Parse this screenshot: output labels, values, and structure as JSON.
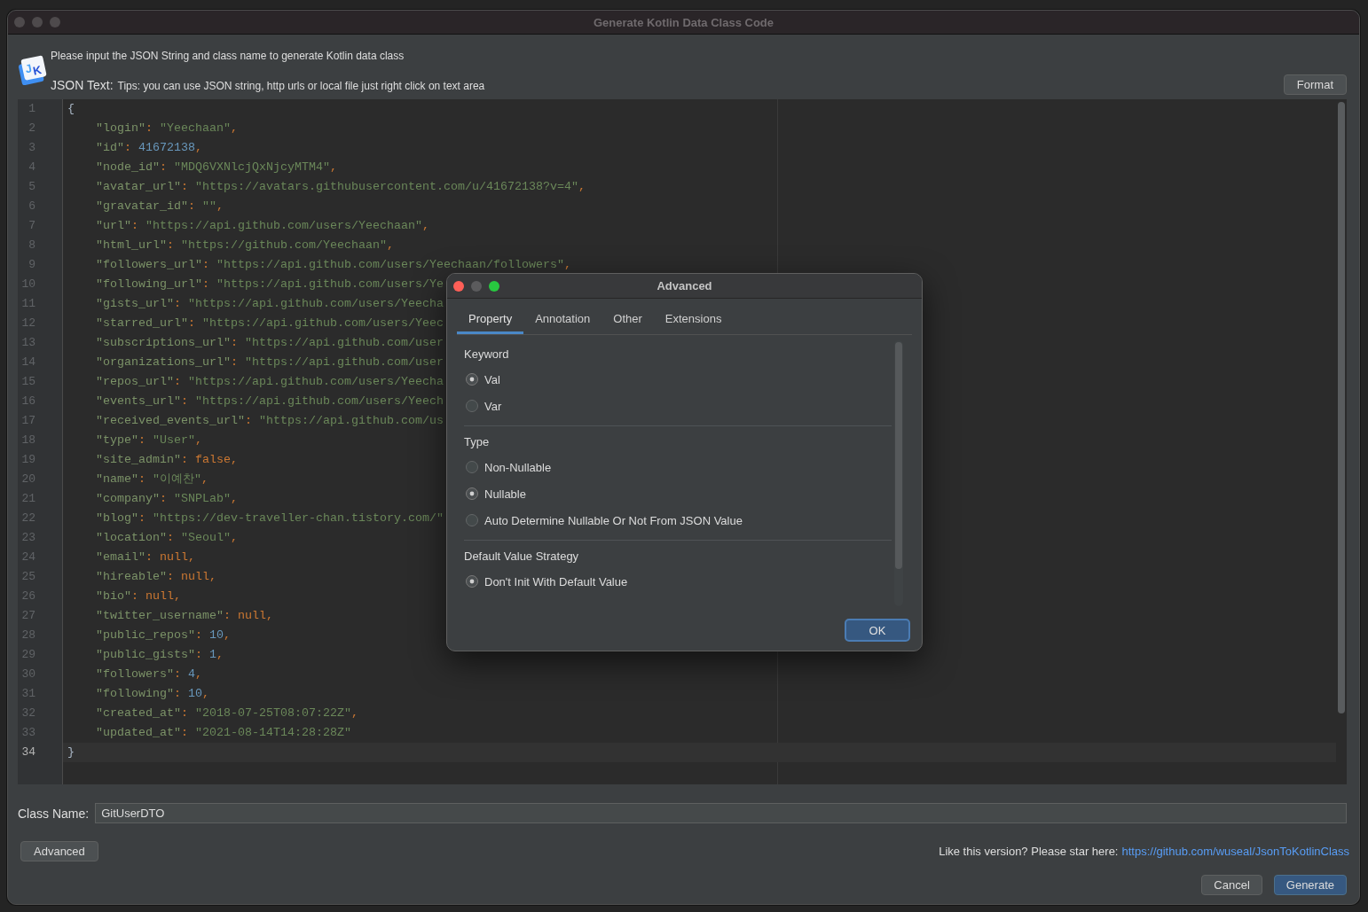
{
  "window": {
    "title": "Generate Kotlin Data Class Code",
    "active": false
  },
  "header": {
    "logo_letters": [
      "J",
      "K"
    ],
    "instruction": "Please input the JSON String and class name to generate Kotlin data class",
    "json_text_label": "JSON Text:",
    "tips": "Tips: you can use JSON string, http urls or local file just right click on text area",
    "format_button": "Format"
  },
  "editor": {
    "lines": [
      {
        "number": "1",
        "current": false,
        "tokens": [
          {
            "kind": "brace",
            "text": "{"
          }
        ],
        "children": [
          {
            "number": "2",
            "current": false,
            "tokens": [
              {
                "kind": "key",
                "text": "\"login\""
              },
              {
                "kind": "punct",
                "text": ": "
              },
              {
                "kind": "string",
                "text": "\"Yeechaan\""
              },
              {
                "kind": "punct",
                "text": ","
              }
            ]
          },
          {
            "number": "3",
            "current": false,
            "tokens": [
              {
                "kind": "key",
                "text": "\"id\""
              },
              {
                "kind": "punct",
                "text": ": "
              },
              {
                "kind": "number",
                "text": "41672138"
              },
              {
                "kind": "punct",
                "text": ","
              }
            ]
          },
          {
            "number": "4",
            "current": false,
            "tokens": [
              {
                "kind": "key",
                "text": "\"node_id\""
              },
              {
                "kind": "punct",
                "text": ": "
              },
              {
                "kind": "string",
                "text": "\"MDQ6VXNlcjQxNjcyMTM4\""
              },
              {
                "kind": "punct",
                "text": ","
              }
            ]
          },
          {
            "number": "5",
            "current": false,
            "tokens": [
              {
                "kind": "key",
                "text": "\"avatar_url\""
              },
              {
                "kind": "punct",
                "text": ": "
              },
              {
                "kind": "string",
                "text": "\"https://avatars.githubusercontent.com/u/41672138?v=4\""
              },
              {
                "kind": "punct",
                "text": ","
              }
            ]
          },
          {
            "number": "6",
            "current": false,
            "tokens": [
              {
                "kind": "key",
                "text": "\"gravatar_id\""
              },
              {
                "kind": "punct",
                "text": ": "
              },
              {
                "kind": "string",
                "text": "\"\""
              },
              {
                "kind": "punct",
                "text": ","
              }
            ]
          },
          {
            "number": "7",
            "current": false,
            "tokens": [
              {
                "kind": "key",
                "text": "\"url\""
              },
              {
                "kind": "punct",
                "text": ": "
              },
              {
                "kind": "string",
                "text": "\"https://api.github.com/users/Yeechaan\""
              },
              {
                "kind": "punct",
                "text": ","
              }
            ]
          },
          {
            "number": "8",
            "current": false,
            "tokens": [
              {
                "kind": "key",
                "text": "\"html_url\""
              },
              {
                "kind": "punct",
                "text": ": "
              },
              {
                "kind": "string",
                "text": "\"https://github.com/Yeechaan\""
              },
              {
                "kind": "punct",
                "text": ","
              }
            ]
          },
          {
            "number": "9",
            "current": false,
            "tokens": [
              {
                "kind": "key",
                "text": "\"followers_url\""
              },
              {
                "kind": "punct",
                "text": ": "
              },
              {
                "kind": "string",
                "text": "\"https://api.github.com/users/Yeechaan/followers\""
              },
              {
                "kind": "punct",
                "text": ","
              }
            ]
          },
          {
            "number": "10",
            "current": false,
            "tokens": [
              {
                "kind": "key",
                "text": "\"following_url\""
              },
              {
                "kind": "punct",
                "text": ": "
              },
              {
                "kind": "string",
                "text": "\"https://api.github.com/users/Ye"
              }
            ]
          },
          {
            "number": "11",
            "current": false,
            "tokens": [
              {
                "kind": "key",
                "text": "\"gists_url\""
              },
              {
                "kind": "punct",
                "text": ": "
              },
              {
                "kind": "string",
                "text": "\"https://api.github.com/users/Yeecha"
              }
            ]
          },
          {
            "number": "12",
            "current": false,
            "tokens": [
              {
                "kind": "key",
                "text": "\"starred_url\""
              },
              {
                "kind": "punct",
                "text": ": "
              },
              {
                "kind": "string",
                "text": "\"https://api.github.com/users/Yeec"
              }
            ]
          },
          {
            "number": "13",
            "current": false,
            "tokens": [
              {
                "kind": "key",
                "text": "\"subscriptions_url\""
              },
              {
                "kind": "punct",
                "text": ": "
              },
              {
                "kind": "string",
                "text": "\"https://api.github.com/user"
              }
            ]
          },
          {
            "number": "14",
            "current": false,
            "tokens": [
              {
                "kind": "key",
                "text": "\"organizations_url\""
              },
              {
                "kind": "punct",
                "text": ": "
              },
              {
                "kind": "string",
                "text": "\"https://api.github.com/user"
              }
            ]
          },
          {
            "number": "15",
            "current": false,
            "tokens": [
              {
                "kind": "key",
                "text": "\"repos_url\""
              },
              {
                "kind": "punct",
                "text": ": "
              },
              {
                "kind": "string",
                "text": "\"https://api.github.com/users/Yeecha"
              }
            ]
          },
          {
            "number": "16",
            "current": false,
            "tokens": [
              {
                "kind": "key",
                "text": "\"events_url\""
              },
              {
                "kind": "punct",
                "text": ": "
              },
              {
                "kind": "string",
                "text": "\"https://api.github.com/users/Yeech"
              }
            ]
          },
          {
            "number": "17",
            "current": false,
            "tokens": [
              {
                "kind": "key",
                "text": "\"received_events_url\""
              },
              {
                "kind": "punct",
                "text": ": "
              },
              {
                "kind": "string",
                "text": "\"https://api.github.com/us"
              }
            ]
          },
          {
            "number": "18",
            "current": false,
            "tokens": [
              {
                "kind": "key",
                "text": "\"type\""
              },
              {
                "kind": "punct",
                "text": ": "
              },
              {
                "kind": "string",
                "text": "\"User\""
              },
              {
                "kind": "punct",
                "text": ","
              }
            ]
          },
          {
            "number": "19",
            "current": false,
            "tokens": [
              {
                "kind": "key",
                "text": "\"site_admin\""
              },
              {
                "kind": "punct",
                "text": ": "
              },
              {
                "kind": "keyword",
                "text": "false"
              },
              {
                "kind": "punct",
                "text": ","
              }
            ]
          },
          {
            "number": "20",
            "current": false,
            "tokens": [
              {
                "kind": "key",
                "text": "\"name\""
              },
              {
                "kind": "punct",
                "text": ": "
              },
              {
                "kind": "string",
                "text": "\"이예찬\""
              },
              {
                "kind": "punct",
                "text": ","
              }
            ]
          },
          {
            "number": "21",
            "current": false,
            "tokens": [
              {
                "kind": "key",
                "text": "\"company\""
              },
              {
                "kind": "punct",
                "text": ": "
              },
              {
                "kind": "string",
                "text": "\"SNPLab\""
              },
              {
                "kind": "punct",
                "text": ","
              }
            ]
          },
          {
            "number": "22",
            "current": false,
            "tokens": [
              {
                "kind": "key",
                "text": "\"blog\""
              },
              {
                "kind": "punct",
                "text": ": "
              },
              {
                "kind": "string",
                "text": "\"https://dev-traveller-chan.tistory.com/\""
              }
            ]
          },
          {
            "number": "23",
            "current": false,
            "tokens": [
              {
                "kind": "key",
                "text": "\"location\""
              },
              {
                "kind": "punct",
                "text": ": "
              },
              {
                "kind": "string",
                "text": "\"Seoul\""
              },
              {
                "kind": "punct",
                "text": ","
              }
            ]
          },
          {
            "number": "24",
            "current": false,
            "tokens": [
              {
                "kind": "key",
                "text": "\"email\""
              },
              {
                "kind": "punct",
                "text": ": "
              },
              {
                "kind": "keyword",
                "text": "null"
              },
              {
                "kind": "punct",
                "text": ","
              }
            ]
          },
          {
            "number": "25",
            "current": false,
            "tokens": [
              {
                "kind": "key",
                "text": "\"hireable\""
              },
              {
                "kind": "punct",
                "text": ": "
              },
              {
                "kind": "keyword",
                "text": "null"
              },
              {
                "kind": "punct",
                "text": ","
              }
            ]
          },
          {
            "number": "26",
            "current": false,
            "tokens": [
              {
                "kind": "key",
                "text": "\"bio\""
              },
              {
                "kind": "punct",
                "text": ": "
              },
              {
                "kind": "keyword",
                "text": "null"
              },
              {
                "kind": "punct",
                "text": ","
              }
            ]
          },
          {
            "number": "27",
            "current": false,
            "tokens": [
              {
                "kind": "key",
                "text": "\"twitter_username\""
              },
              {
                "kind": "punct",
                "text": ": "
              },
              {
                "kind": "keyword",
                "text": "null"
              },
              {
                "kind": "punct",
                "text": ","
              }
            ]
          },
          {
            "number": "28",
            "current": false,
            "tokens": [
              {
                "kind": "key",
                "text": "\"public_repos\""
              },
              {
                "kind": "punct",
                "text": ": "
              },
              {
                "kind": "number",
                "text": "10"
              },
              {
                "kind": "punct",
                "text": ","
              }
            ]
          },
          {
            "number": "29",
            "current": false,
            "tokens": [
              {
                "kind": "key",
                "text": "\"public_gists\""
              },
              {
                "kind": "punct",
                "text": ": "
              },
              {
                "kind": "number",
                "text": "1"
              },
              {
                "kind": "punct",
                "text": ","
              }
            ]
          },
          {
            "number": "30",
            "current": false,
            "tokens": [
              {
                "kind": "key",
                "text": "\"followers\""
              },
              {
                "kind": "punct",
                "text": ": "
              },
              {
                "kind": "number",
                "text": "4"
              },
              {
                "kind": "punct",
                "text": ","
              }
            ]
          },
          {
            "number": "31",
            "current": false,
            "tokens": [
              {
                "kind": "key",
                "text": "\"following\""
              },
              {
                "kind": "punct",
                "text": ": "
              },
              {
                "kind": "number",
                "text": "10"
              },
              {
                "kind": "punct",
                "text": ","
              }
            ]
          },
          {
            "number": "32",
            "current": false,
            "tokens": [
              {
                "kind": "key",
                "text": "\"created_at\""
              },
              {
                "kind": "punct",
                "text": ": "
              },
              {
                "kind": "string",
                "text": "\"2018-07-25T08:07:22Z\""
              },
              {
                "kind": "punct",
                "text": ","
              }
            ]
          },
          {
            "number": "33",
            "current": false,
            "tokens": [
              {
                "kind": "key",
                "text": "\"updated_at\""
              },
              {
                "kind": "punct",
                "text": ": "
              },
              {
                "kind": "string",
                "text": "\"2021-08-14T14:28:28Z\""
              }
            ]
          }
        ]
      },
      {
        "number": "34",
        "current": true,
        "tokens": [
          {
            "kind": "brace",
            "text": "}"
          }
        ]
      }
    ]
  },
  "class_name": {
    "label": "Class Name:",
    "value": "GitUserDTO"
  },
  "advanced_button": "Advanced",
  "star_note": {
    "text": "Like this version? Please star here:",
    "link": "https://github.com/wuseal/JsonToKotlinClass"
  },
  "buttons": [
    {
      "label": "Cancel",
      "primary": false
    },
    {
      "label": "Generate",
      "primary": true
    }
  ],
  "dialog": {
    "title": "Advanced",
    "active": true,
    "tabs": [
      {
        "label": "Property",
        "selected": true
      },
      {
        "label": "Annotation",
        "selected": false
      },
      {
        "label": "Other",
        "selected": false
      },
      {
        "label": "Extensions",
        "selected": false
      }
    ],
    "sections": [
      {
        "heading": "Keyword",
        "options": [
          {
            "label": "Val",
            "selected": true
          },
          {
            "label": "Var",
            "selected": false
          }
        ]
      },
      {
        "heading": "Type",
        "options": [
          {
            "label": "Non-Nullable",
            "selected": false
          },
          {
            "label": "Nullable",
            "selected": true
          },
          {
            "label": "Auto Determine Nullable Or Not From JSON Value",
            "selected": false
          }
        ]
      },
      {
        "heading": "Default Value Strategy",
        "options": [
          {
            "label": "Don't Init With Default Value",
            "selected": true
          }
        ]
      }
    ],
    "ok_button": "OK"
  }
}
